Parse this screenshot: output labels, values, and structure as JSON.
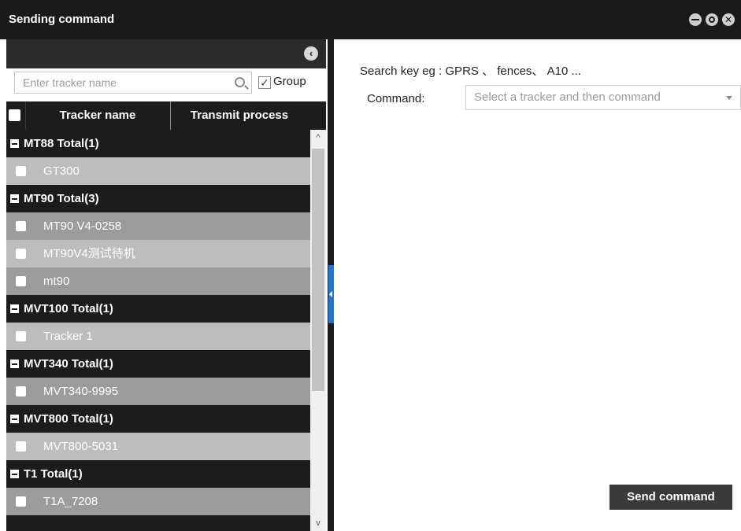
{
  "window": {
    "title": "Sending command",
    "controls": {
      "minimize_icon": "minimize-icon",
      "restore_icon": "restore-icon",
      "close_icon": "close-icon",
      "close_glyph": "✕"
    }
  },
  "left_panel": {
    "collapse_glyph": "‹",
    "search": {
      "placeholder": "Enter tracker name",
      "value": ""
    },
    "group_toggle": {
      "label": "Group",
      "checked": true,
      "tick": "✓"
    },
    "columns": [
      "Tracker name",
      "Transmit process"
    ],
    "groups": [
      {
        "label": "MT88 Total(1)",
        "items": [
          "GT300"
        ]
      },
      {
        "label": "MT90 Total(3)",
        "items": [
          "MT90 V4-0258",
          "MT90V4测试待机",
          "mt90"
        ]
      },
      {
        "label": "MVT100 Total(1)",
        "items": [
          "Tracker 1"
        ]
      },
      {
        "label": "MVT340 Total(1)",
        "items": [
          "MVT340-9995"
        ]
      },
      {
        "label": "MVT800 Total(1)",
        "items": [
          "MVT800-5031"
        ]
      },
      {
        "label": "T1 Total(1)",
        "items": [
          "T1A_7208"
        ]
      }
    ],
    "scroll": {
      "up_glyph": "^",
      "down_glyph": "v"
    }
  },
  "right_panel": {
    "search_hint": "Search key eg : GPRS 、 fences、 A10 ...",
    "command_label": "Command:",
    "command_placeholder": "Select a tracker and then command",
    "send_button": "Send command"
  },
  "colors": {
    "titlebar": "#1a1a1a",
    "group_row": "#1c1c1c",
    "item_row_light": "#bdbdbd",
    "item_row_dark": "#9b9b9b",
    "splitter_accent": "#1e78d2",
    "send_button": "#3a3a3a"
  }
}
